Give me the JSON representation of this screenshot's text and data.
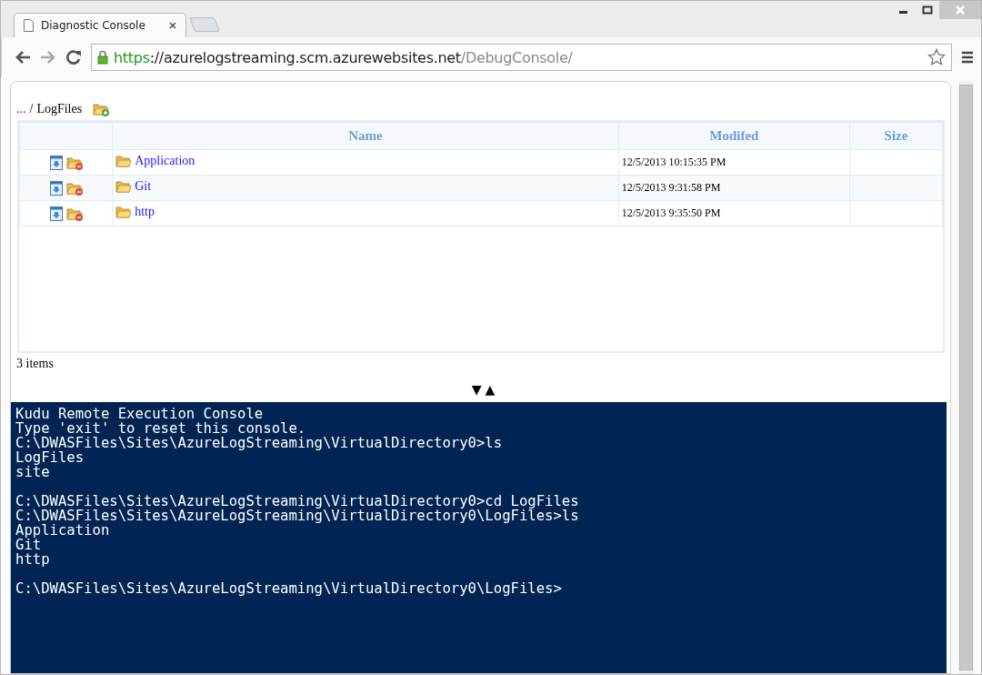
{
  "browser": {
    "tab_title": "Diagnostic Console",
    "url_scheme": "https",
    "url_host": "://azurelogstreaming.scm.azurewebsites.net",
    "url_path": "/DebugConsole/"
  },
  "breadcrumb": {
    "parent": "...",
    "separator": "/",
    "current": "LogFiles"
  },
  "table": {
    "columns": [
      "Name",
      "Modifed",
      "Size"
    ],
    "rows": [
      {
        "name": "Application",
        "modified": "12/5/2013 10:15:35 PM"
      },
      {
        "name": "Git",
        "modified": "12/5/2013 9:31:58 PM"
      },
      {
        "name": "http",
        "modified": "12/5/2013 9:35:50 PM"
      }
    ]
  },
  "item_count": "3 items",
  "resize_controls": [
    "▼",
    "▲"
  ],
  "console": {
    "blocks": [
      [
        "Kudu Remote Execution Console",
        "Type 'exit' to reset this console.",
        "C:\\DWASFiles\\Sites\\AzureLogStreaming\\VirtualDirectory0>ls",
        "LogFiles",
        "site"
      ],
      [
        "C:\\DWASFiles\\Sites\\AzureLogStreaming\\VirtualDirectory0>cd LogFiles",
        "C:\\DWASFiles\\Sites\\AzureLogStreaming\\VirtualDirectory0\\LogFiles>ls",
        "Application",
        "Git",
        "http"
      ],
      [
        "C:\\DWASFiles\\Sites\\AzureLogStreaming\\VirtualDirectory0\\LogFiles>"
      ]
    ]
  }
}
